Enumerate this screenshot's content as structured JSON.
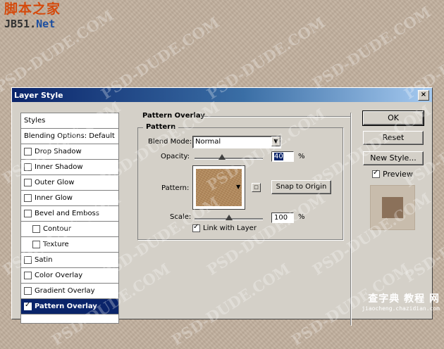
{
  "site_logo": {
    "cn": "脚本之家",
    "en_prefix": "JB51.",
    "en_suffix": "Net"
  },
  "watermark_text": "PSD-DUDE.COM",
  "dialog": {
    "title": "Layer Style",
    "close_glyph": "×",
    "styles_list": [
      {
        "label": "Styles",
        "checkbox": false,
        "indent": false
      },
      {
        "label": "Blending Options: Default",
        "checkbox": false,
        "indent": false
      },
      {
        "label": "Drop Shadow",
        "checkbox": true,
        "checked": false,
        "indent": false
      },
      {
        "label": "Inner Shadow",
        "checkbox": true,
        "checked": false,
        "indent": false
      },
      {
        "label": "Outer Glow",
        "checkbox": true,
        "checked": false,
        "indent": false
      },
      {
        "label": "Inner Glow",
        "checkbox": true,
        "checked": false,
        "indent": false
      },
      {
        "label": "Bevel and Emboss",
        "checkbox": true,
        "checked": false,
        "indent": false
      },
      {
        "label": "Contour",
        "checkbox": true,
        "checked": false,
        "indent": true
      },
      {
        "label": "Texture",
        "checkbox": true,
        "checked": false,
        "indent": true
      },
      {
        "label": "Satin",
        "checkbox": true,
        "checked": false,
        "indent": false
      },
      {
        "label": "Color Overlay",
        "checkbox": true,
        "checked": false,
        "indent": false
      },
      {
        "label": "Gradient Overlay",
        "checkbox": true,
        "checked": false,
        "indent": false
      },
      {
        "label": "Pattern Overlay",
        "checkbox": true,
        "checked": true,
        "indent": false,
        "selected": true
      }
    ],
    "pattern_overlay": {
      "section_title": "Pattern Overlay",
      "group_title": "Pattern",
      "blend_mode_label": "Blend Mode:",
      "blend_mode_value": "Normal",
      "opacity_label": "Opacity:",
      "opacity_value": "40",
      "opacity_fraction": 0.4,
      "percent": "%",
      "pattern_label": "Pattern:",
      "snap_button": "Snap to Origin",
      "scale_label": "Scale:",
      "scale_value": "100",
      "scale_fraction": 0.5,
      "link_label": "Link with Layer",
      "link_checked": true
    },
    "buttons": {
      "ok": "OK",
      "reset": "Reset",
      "new_style": "New Style...",
      "preview_label": "Preview",
      "preview_checked": true
    },
    "colors": {
      "pattern": "#b38b5f",
      "preview_swatch": "#8b715a",
      "selection": "#0a246a"
    }
  },
  "footer_logo": {
    "line1": "查字典 教程 网",
    "line2": "jiaocheng.chazidian.com"
  }
}
